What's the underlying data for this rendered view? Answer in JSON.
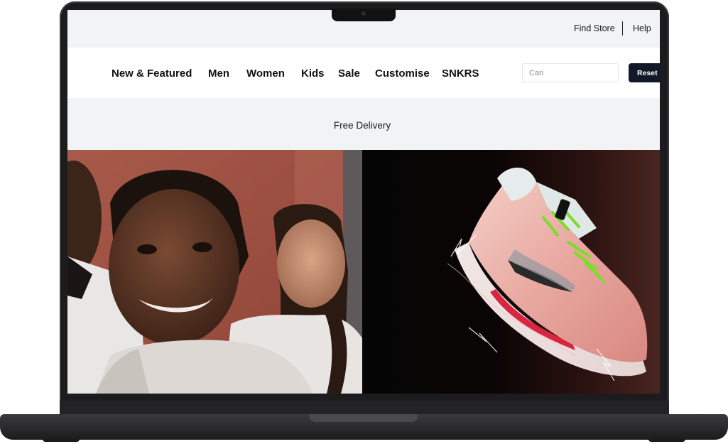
{
  "utility_bar": {
    "find_store": "Find Store",
    "help": "Help"
  },
  "nav": {
    "items": [
      {
        "label": "New & Featured"
      },
      {
        "label": "Men"
      },
      {
        "label": "Women"
      },
      {
        "label": "Kids"
      },
      {
        "label": "Sale"
      },
      {
        "label": "Customise"
      },
      {
        "label": "SNKRS"
      }
    ]
  },
  "search": {
    "placeholder": "Cari",
    "value": ""
  },
  "reset_button": {
    "label": "Reset"
  },
  "promo": {
    "text": "Free Delivery"
  },
  "colors": {
    "nav_text": "#111111",
    "reset_bg": "#111827",
    "utility_bg": "#f2f3f5",
    "device_frame": "#1c1c1e"
  },
  "icons": [
    "camera-icon"
  ]
}
